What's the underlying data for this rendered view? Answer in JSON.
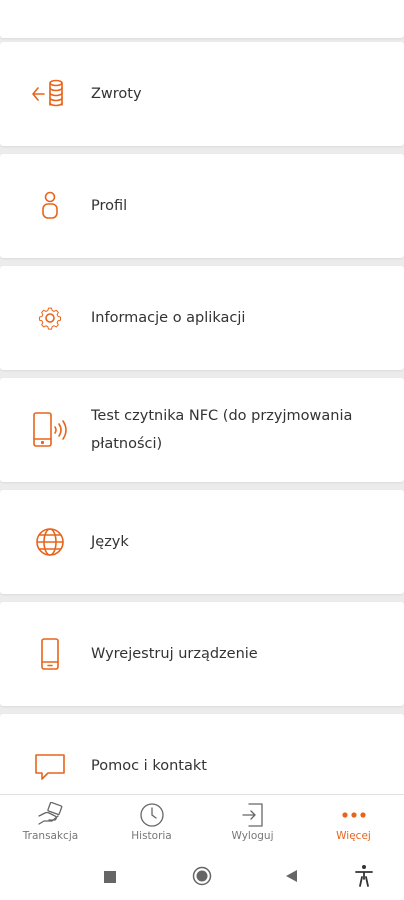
{
  "colors": {
    "accent": "#e8641b",
    "background": "#ececec",
    "card": "#ffffff",
    "text": "#333333",
    "muted": "#777777"
  },
  "menu": {
    "items": [
      {
        "label": "Zwroty",
        "icon": "refund-coins-icon"
      },
      {
        "label": "Profil",
        "icon": "person-icon"
      },
      {
        "label": "Informacje o aplikacji",
        "icon": "gear-icon"
      },
      {
        "label": "Test czytnika NFC (do przyjmowania płatności)",
        "icon": "nfc-phone-icon"
      },
      {
        "label": "Język",
        "icon": "globe-icon"
      },
      {
        "label": "Wyrejestruj urządzenie",
        "icon": "phone-icon"
      },
      {
        "label": "Pomoc i kontakt",
        "icon": "chat-icon"
      }
    ]
  },
  "tabbar": {
    "tabs": [
      {
        "label": "Transakcja",
        "icon": "hand-card-icon",
        "active": false
      },
      {
        "label": "Historia",
        "icon": "clock-icon",
        "active": false
      },
      {
        "label": "Wyloguj",
        "icon": "logout-icon",
        "active": false
      },
      {
        "label": "Więcej",
        "icon": "more-dots-icon",
        "active": true
      }
    ]
  },
  "system_nav": {
    "icons": [
      "square-icon",
      "circle-home-icon",
      "back-triangle-icon",
      "accessibility-icon"
    ]
  }
}
